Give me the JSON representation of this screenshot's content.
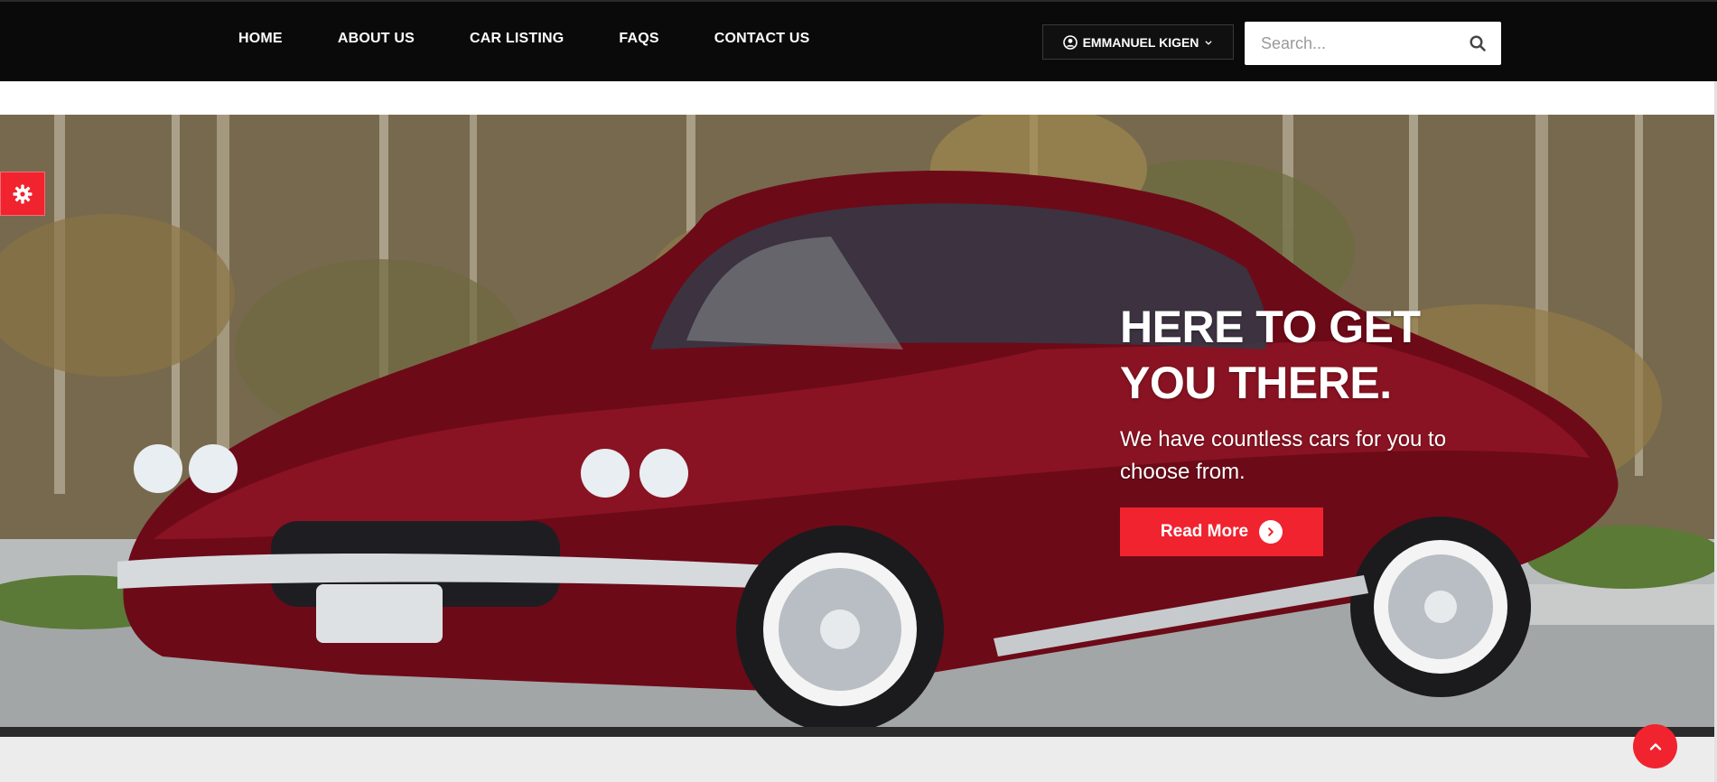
{
  "nav": {
    "items": [
      "HOME",
      "ABOUT US",
      "CAR LISTING",
      "FAQS",
      "CONTACT US"
    ]
  },
  "user": {
    "name": "EMMANUEL KIGEN"
  },
  "search": {
    "placeholder": "Search..."
  },
  "hero": {
    "title_line1": "HERE TO GET",
    "title_line2": "YOU THERE.",
    "subtitle": "We have countless cars for you to choose from.",
    "button_label": "Read More"
  },
  "colors": {
    "accent": "#f0232f",
    "nav_bg": "#0a0a0a"
  },
  "icons": {
    "user": "user-circle-icon",
    "chevron": "chevron-down-icon",
    "search": "search-icon",
    "gear": "gear-icon",
    "arrow": "arrow-right-circle-icon",
    "scroll_top": "chevron-up-icon"
  }
}
